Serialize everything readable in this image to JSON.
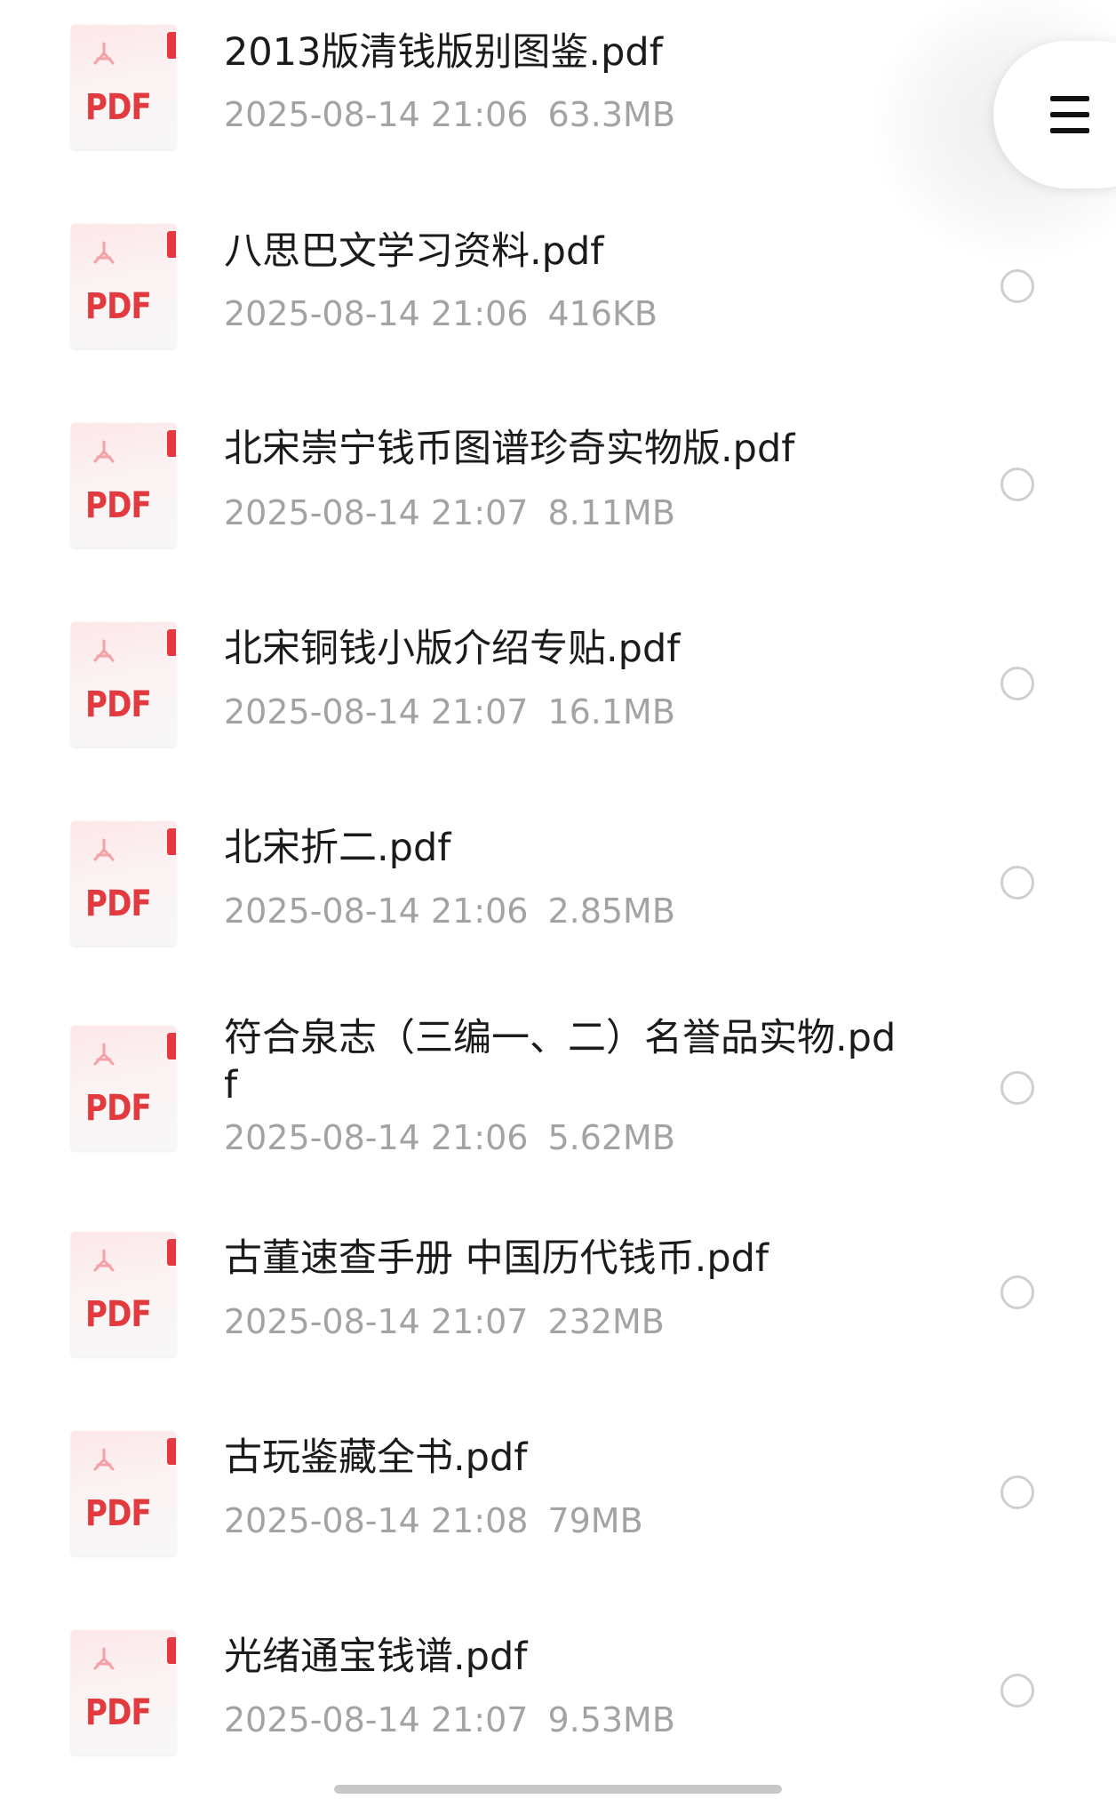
{
  "file_icon_label": "PDF",
  "files": [
    {
      "name": "2013版清钱版别图鉴.pdf",
      "date": "2025-08-14 21:06",
      "size": "63.3MB"
    },
    {
      "name": "八思巴文学习资料.pdf",
      "date": "2025-08-14 21:06",
      "size": "416KB"
    },
    {
      "name": "北宋崇宁钱币图谱珍奇实物版.pdf",
      "date": "2025-08-14 21:07",
      "size": "8.11MB"
    },
    {
      "name": "北宋铜钱小版介绍专贴.pdf",
      "date": "2025-08-14 21:07",
      "size": "16.1MB"
    },
    {
      "name": "北宋折二.pdf",
      "date": "2025-08-14 21:06",
      "size": "2.85MB"
    },
    {
      "name": "符合泉志（三编一、二）名誉品实物.pdf",
      "date": "2025-08-14 21:06",
      "size": "5.62MB"
    },
    {
      "name": "古董速查手册 中国历代钱币.pdf",
      "date": "2025-08-14 21:07",
      "size": "232MB"
    },
    {
      "name": "古玩鉴藏全书.pdf",
      "date": "2025-08-14 21:08",
      "size": "79MB"
    },
    {
      "name": "光绪通宝钱谱.pdf",
      "date": "2025-08-14 21:07",
      "size": "9.53MB"
    }
  ],
  "icons": {
    "file_type": "pdf-file-icon",
    "menu": "menu-icon",
    "select": "radio-unchecked-icon"
  },
  "colors": {
    "pdf_red": "#e23b3f",
    "meta_gray": "#a3a3a3",
    "radio_gray": "#cfcfcf"
  }
}
